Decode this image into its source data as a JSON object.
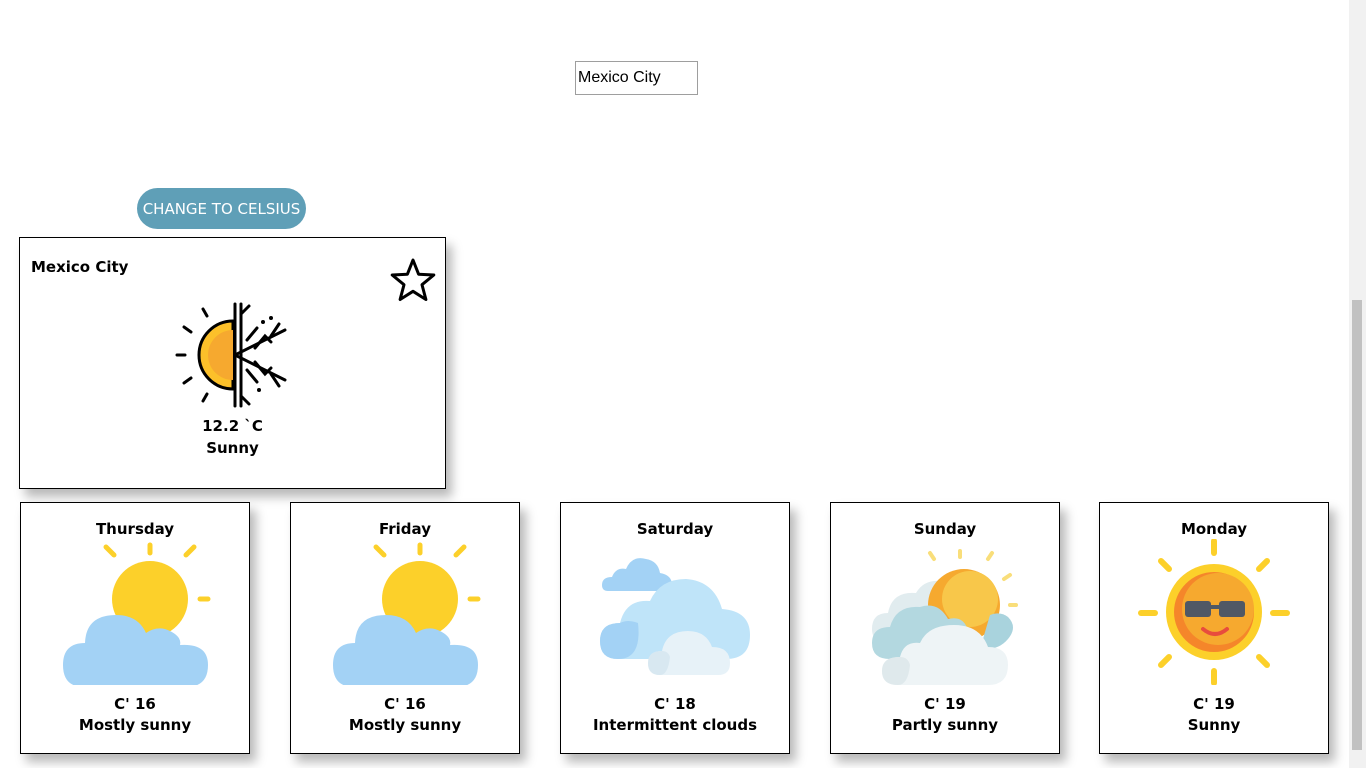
{
  "search": {
    "value": "Mexico City"
  },
  "unit_button": {
    "label": "CHANGE TO CELSIUS"
  },
  "current": {
    "city": "Mexico City",
    "temperature": "12.2 `C",
    "condition": "Sunny",
    "icon": "sun-snowflake-icon",
    "favorite_icon": "star-outline-icon"
  },
  "forecast": [
    {
      "day": "Thursday",
      "temp": "C' 16",
      "condition": "Mostly sunny",
      "icon": "sun-behind-cloud-icon"
    },
    {
      "day": "Friday",
      "temp": "C' 16",
      "condition": "Mostly sunny",
      "icon": "sun-behind-cloud-icon"
    },
    {
      "day": "Saturday",
      "temp": "C' 18",
      "condition": "Intermittent clouds",
      "icon": "clouds-icon"
    },
    {
      "day": "Sunday",
      "temp": "C' 19",
      "condition": "Partly sunny",
      "icon": "sun-clouds-icon"
    },
    {
      "day": "Monday",
      "temp": "C' 19",
      "condition": "Sunny",
      "icon": "sun-sunglasses-icon"
    }
  ],
  "colors": {
    "button_bg": "#5f9fb7",
    "sun_yellow": "#fcd02a",
    "sun_orange": "#f6a92f",
    "cloud_blue": "#a3d2f5"
  }
}
